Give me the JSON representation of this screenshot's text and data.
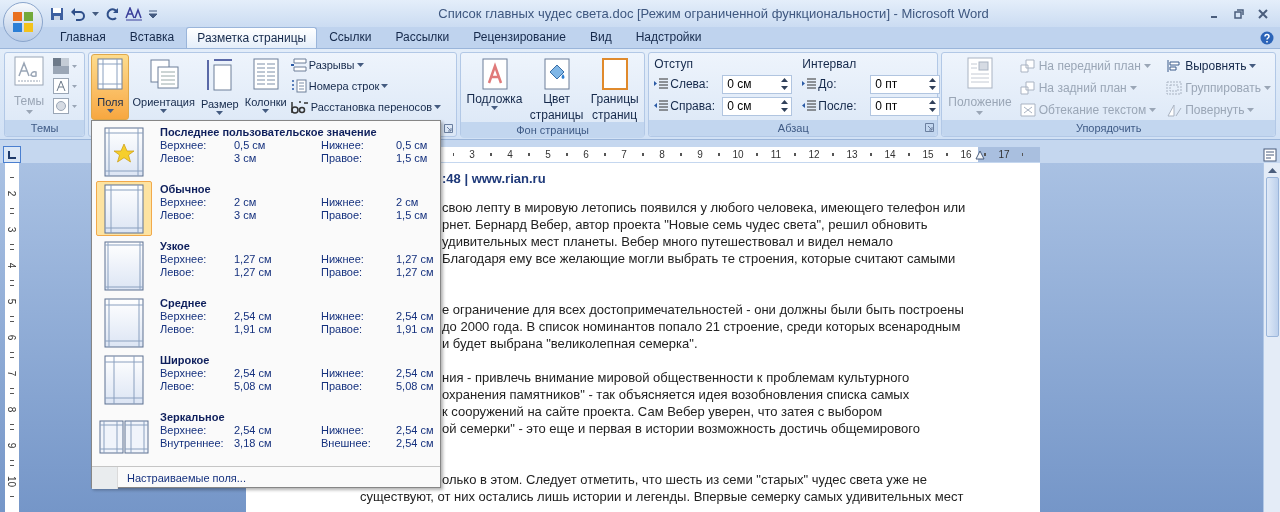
{
  "window": {
    "title": "Список главных чудес света.doc [Режим ограниченной функциональности] - Microsoft Word"
  },
  "tabs": [
    {
      "label": "Главная",
      "selected": false
    },
    {
      "label": "Вставка",
      "selected": false
    },
    {
      "label": "Разметка страницы",
      "selected": true
    },
    {
      "label": "Ссылки",
      "selected": false
    },
    {
      "label": "Рассылки",
      "selected": false
    },
    {
      "label": "Рецензирование",
      "selected": false
    },
    {
      "label": "Вид",
      "selected": false
    },
    {
      "label": "Надстройки",
      "selected": false
    }
  ],
  "themes_group": {
    "label": "Темы",
    "button": {
      "label": "Темы",
      "disabled": true
    }
  },
  "page_setup_group": {
    "buttons": [
      {
        "label": "Поля",
        "selected": true,
        "kind": "margins"
      },
      {
        "label": "Ориентация",
        "selected": false,
        "kind": "orientation"
      },
      {
        "label": "Размер",
        "selected": false,
        "kind": "size"
      },
      {
        "label": "Колонки",
        "selected": false,
        "kind": "columns"
      }
    ],
    "small_buttons": [
      {
        "label": "Разрывы",
        "kind": "breaks"
      },
      {
        "label": "Номера строк",
        "kind": "line-numbers"
      },
      {
        "label": "Расстановка переносов",
        "kind": "hyphenation"
      }
    ]
  },
  "page_background_group": {
    "label": "Фон страницы",
    "buttons": [
      {
        "lines": [
          "Подложка"
        ],
        "kind": "watermark"
      },
      {
        "lines": [
          "Цвет",
          "страницы"
        ],
        "kind": "page-color"
      },
      {
        "lines": [
          "Границы",
          "страниц"
        ],
        "kind": "page-borders"
      }
    ]
  },
  "paragraph_group": {
    "label": "Абзац",
    "indent": {
      "title": "Отступ",
      "fields": [
        {
          "label": "Слева:",
          "value": "0 см"
        },
        {
          "label": "Справа:",
          "value": "0 см"
        }
      ]
    },
    "spacing": {
      "title": "Интервал",
      "fields": [
        {
          "label": "До:",
          "value": "0 пт"
        },
        {
          "label": "После:",
          "value": "0 пт"
        }
      ]
    }
  },
  "arrange_group": {
    "label": "Упорядочить",
    "position": {
      "label": "Положение",
      "disabled": true
    },
    "items": [
      {
        "label": "На передний план",
        "disabled": true
      },
      {
        "label": "На задний план",
        "disabled": true
      },
      {
        "label": "Обтекание текстом",
        "disabled": true
      },
      {
        "label": "Выровнять",
        "disabled": false
      },
      {
        "label": "Группировать",
        "disabled": true
      },
      {
        "label": "Повернуть",
        "disabled": true
      }
    ]
  },
  "margins_menu": {
    "presets": [
      {
        "name": "Последнее пользовательское значение",
        "kind": "custom",
        "selected": false,
        "values": [
          {
            "label": "Верхнее:",
            "value": "0,5 см"
          },
          {
            "label": "Нижнее:",
            "value": "0,5 см"
          },
          {
            "label": "Левое:",
            "value": "3 см"
          },
          {
            "label": "Правое:",
            "value": "1,5 см"
          }
        ]
      },
      {
        "name": "Обычное",
        "kind": "normal",
        "selected": true,
        "values": [
          {
            "label": "Верхнее:",
            "value": "2 см"
          },
          {
            "label": "Нижнее:",
            "value": "2 см"
          },
          {
            "label": "Левое:",
            "value": "3 см"
          },
          {
            "label": "Правое:",
            "value": "1,5 см"
          }
        ]
      },
      {
        "name": "Узкое",
        "kind": "narrow",
        "selected": false,
        "values": [
          {
            "label": "Верхнее:",
            "value": "1,27 см"
          },
          {
            "label": "Нижнее:",
            "value": "1,27 см"
          },
          {
            "label": "Левое:",
            "value": "1,27 см"
          },
          {
            "label": "Правое:",
            "value": "1,27 см"
          }
        ]
      },
      {
        "name": "Среднее",
        "kind": "moderate",
        "selected": false,
        "values": [
          {
            "label": "Верхнее:",
            "value": "2,54 см"
          },
          {
            "label": "Нижнее:",
            "value": "2,54 см"
          },
          {
            "label": "Левое:",
            "value": "1,91 см"
          },
          {
            "label": "Правое:",
            "value": "1,91 см"
          }
        ]
      },
      {
        "name": "Широкое",
        "kind": "wide",
        "selected": false,
        "values": [
          {
            "label": "Верхнее:",
            "value": "2,54 см"
          },
          {
            "label": "Нижнее:",
            "value": "2,54 см"
          },
          {
            "label": "Левое:",
            "value": "5,08 см"
          },
          {
            "label": "Правое:",
            "value": "5,08 см"
          }
        ]
      },
      {
        "name": "Зеркальное",
        "kind": "mirrored",
        "selected": false,
        "values": [
          {
            "label": "Верхнее:",
            "value": "2,54 см"
          },
          {
            "label": "Нижнее:",
            "value": "2,54 см"
          },
          {
            "label": "Внутреннее:",
            "value": "3,18 см"
          },
          {
            "label": "Внешнее:",
            "value": "2,54 см"
          }
        ]
      }
    ],
    "footer": "Настраиваемые поля..."
  },
  "ruler": {
    "numbers": [
      "3",
      "4",
      "5",
      "6",
      "7",
      "8",
      "9",
      "10",
      "11",
      "12",
      "13",
      "14",
      "15",
      "16",
      "17"
    ]
  },
  "vertical_ruler": {
    "numbers": [
      "2",
      "3",
      "4",
      "5",
      "6",
      "7",
      "8",
      "9",
      "10"
    ]
  },
  "document": {
    "header": ":48 | www.rian.ru",
    "paragraphs": [
      [
        "свою лепту в мировую летопись появился у любого человека, имеющего телефон или",
        "рнет. Бернард Вебер, автор проекта \"Новые семь чудес света\", решил обновить",
        "удивительных мест планеты.  Вебер много путешествовал и видел немало",
        "Благодаря ему все желающие могли выбрать те строения, которые считают самыми"
      ],
      [
        "е ограничение для всех достопримечательностей - они должны были быть построены",
        "до 2000 года. В список номинантов попало 21 строение, среди которых всенародным",
        "и будет выбрана \"великолепная семерка\"."
      ],
      [
        "ния  - привлечь внимание  мировой общественности к проблемам культурного",
        "охранения памятников\" - так объясняется идея возобновления списка самых",
        "к сооружений на сайте проекта. Сам Вебер уверен, что затея с выбором",
        "ой семерки\" - это еще и первая в истории возможность достичь общемирового"
      ],
      [
        "олько в этом. Следует отметить, что шесть из семи \"старых\" чудес света уже не",
        "существуют, от них остались лишь истории и легенды. Впервые семерку самых удивительных мест"
      ]
    ]
  }
}
